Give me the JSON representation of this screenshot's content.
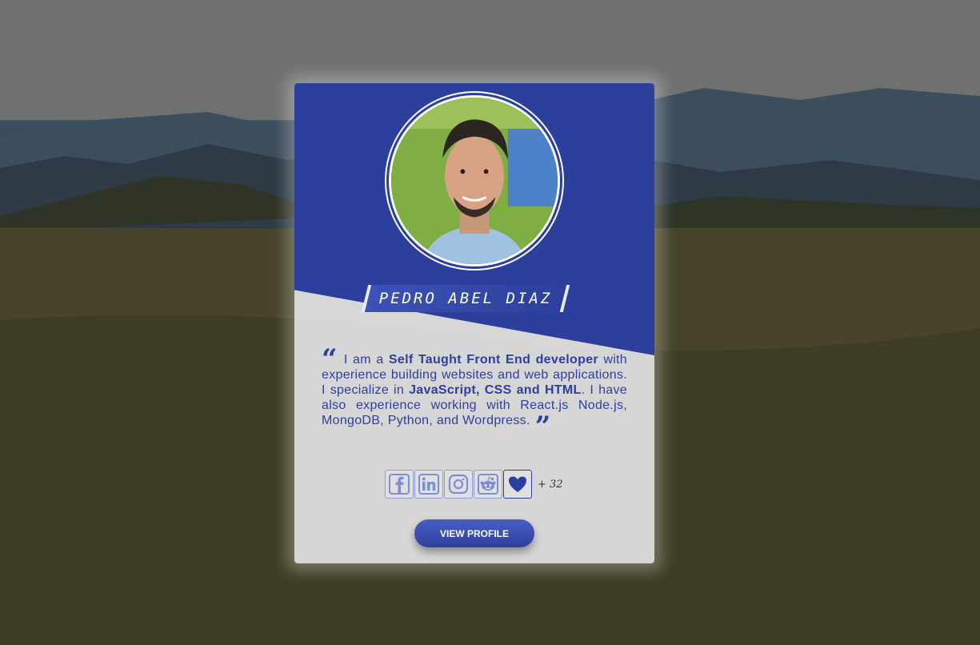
{
  "profile": {
    "name": "PEDRO ABEL DIAZ",
    "bio_intro": "I am a ",
    "bio_role": "Self Taught Front End developer",
    "bio_mid": " with experience building websites and web applications. I specialize in ",
    "bio_skills": "JavaScript, CSS and HTML",
    "bio_end": ". I have also experience working with React.js Node.js, MongoDB, Python, and Wordpress.",
    "quote_open": "“",
    "quote_close": "”"
  },
  "social": {
    "icons": [
      "facebook-icon",
      "linkedin-icon",
      "instagram-icon",
      "reddit-icon",
      "heart-icon"
    ],
    "likes": "+ 32"
  },
  "actions": {
    "view_profile": "VIEW PROFILE"
  },
  "colors": {
    "accent": "#2c3f9c",
    "card_bg": "#f0f0f4"
  }
}
